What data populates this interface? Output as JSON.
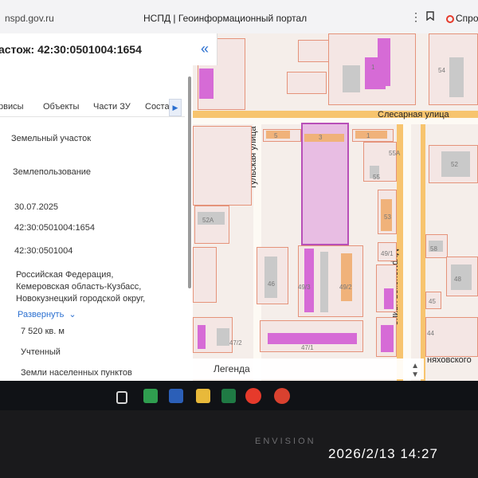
{
  "browser": {
    "url": "nspd.gov.ru",
    "tab_title": "НСПД | Геоинформационный портал",
    "help_label": "Спро"
  },
  "panel": {
    "title": "астож: 42:30:0501004:1654",
    "tabs": [
      "рвисы",
      "Объекты",
      "Части ЗУ",
      "Соста"
    ],
    "rows": [
      "Земельный участок",
      "Землепользование",
      "30.07.2025",
      "42:30:0501004:1654",
      "42:30:0501004"
    ],
    "address_lines": [
      "Российская Федерация,",
      "Кемеровская область-Кузбасс,",
      "Новокузнецкий городской округ,"
    ],
    "expand_label": "Развернуть",
    "area": "7 520 кв. м",
    "status": "Учтенный",
    "category": "Земли населенных пунктов"
  },
  "map": {
    "streets": {
      "slesarnaya": "Слесарная улица",
      "tulskaya": "Тульская улица",
      "murmanskaya": "Мурманская улица",
      "nyakhovskogo": "няховского"
    },
    "labels": [
      "1",
      "54",
      "5",
      "3",
      "1",
      "55А",
      "55",
      "52",
      "53",
      "58",
      "48",
      "49/1",
      "52А",
      "46",
      "49/3",
      "49/2",
      "45",
      "44",
      "47/1",
      "47/2"
    ]
  },
  "legend": {
    "title": "Легенда"
  },
  "taskbar": {
    "icons": [
      "task-view-icon",
      "photos-icon",
      "word-icon",
      "file-manager-icon",
      "excel-icon",
      "yandex-browser-icon",
      "yandex-alt-icon"
    ]
  },
  "photo": {
    "monitor_brand": "ENVISION",
    "timestamp": "2026/2/13 14:27"
  },
  "colors": {
    "parcel_border": "#e5937a",
    "selected_parcel": "#b84fb8",
    "building_pink": "#d66bd6",
    "road": "#f7c46e",
    "link": "#2a6fd0"
  }
}
